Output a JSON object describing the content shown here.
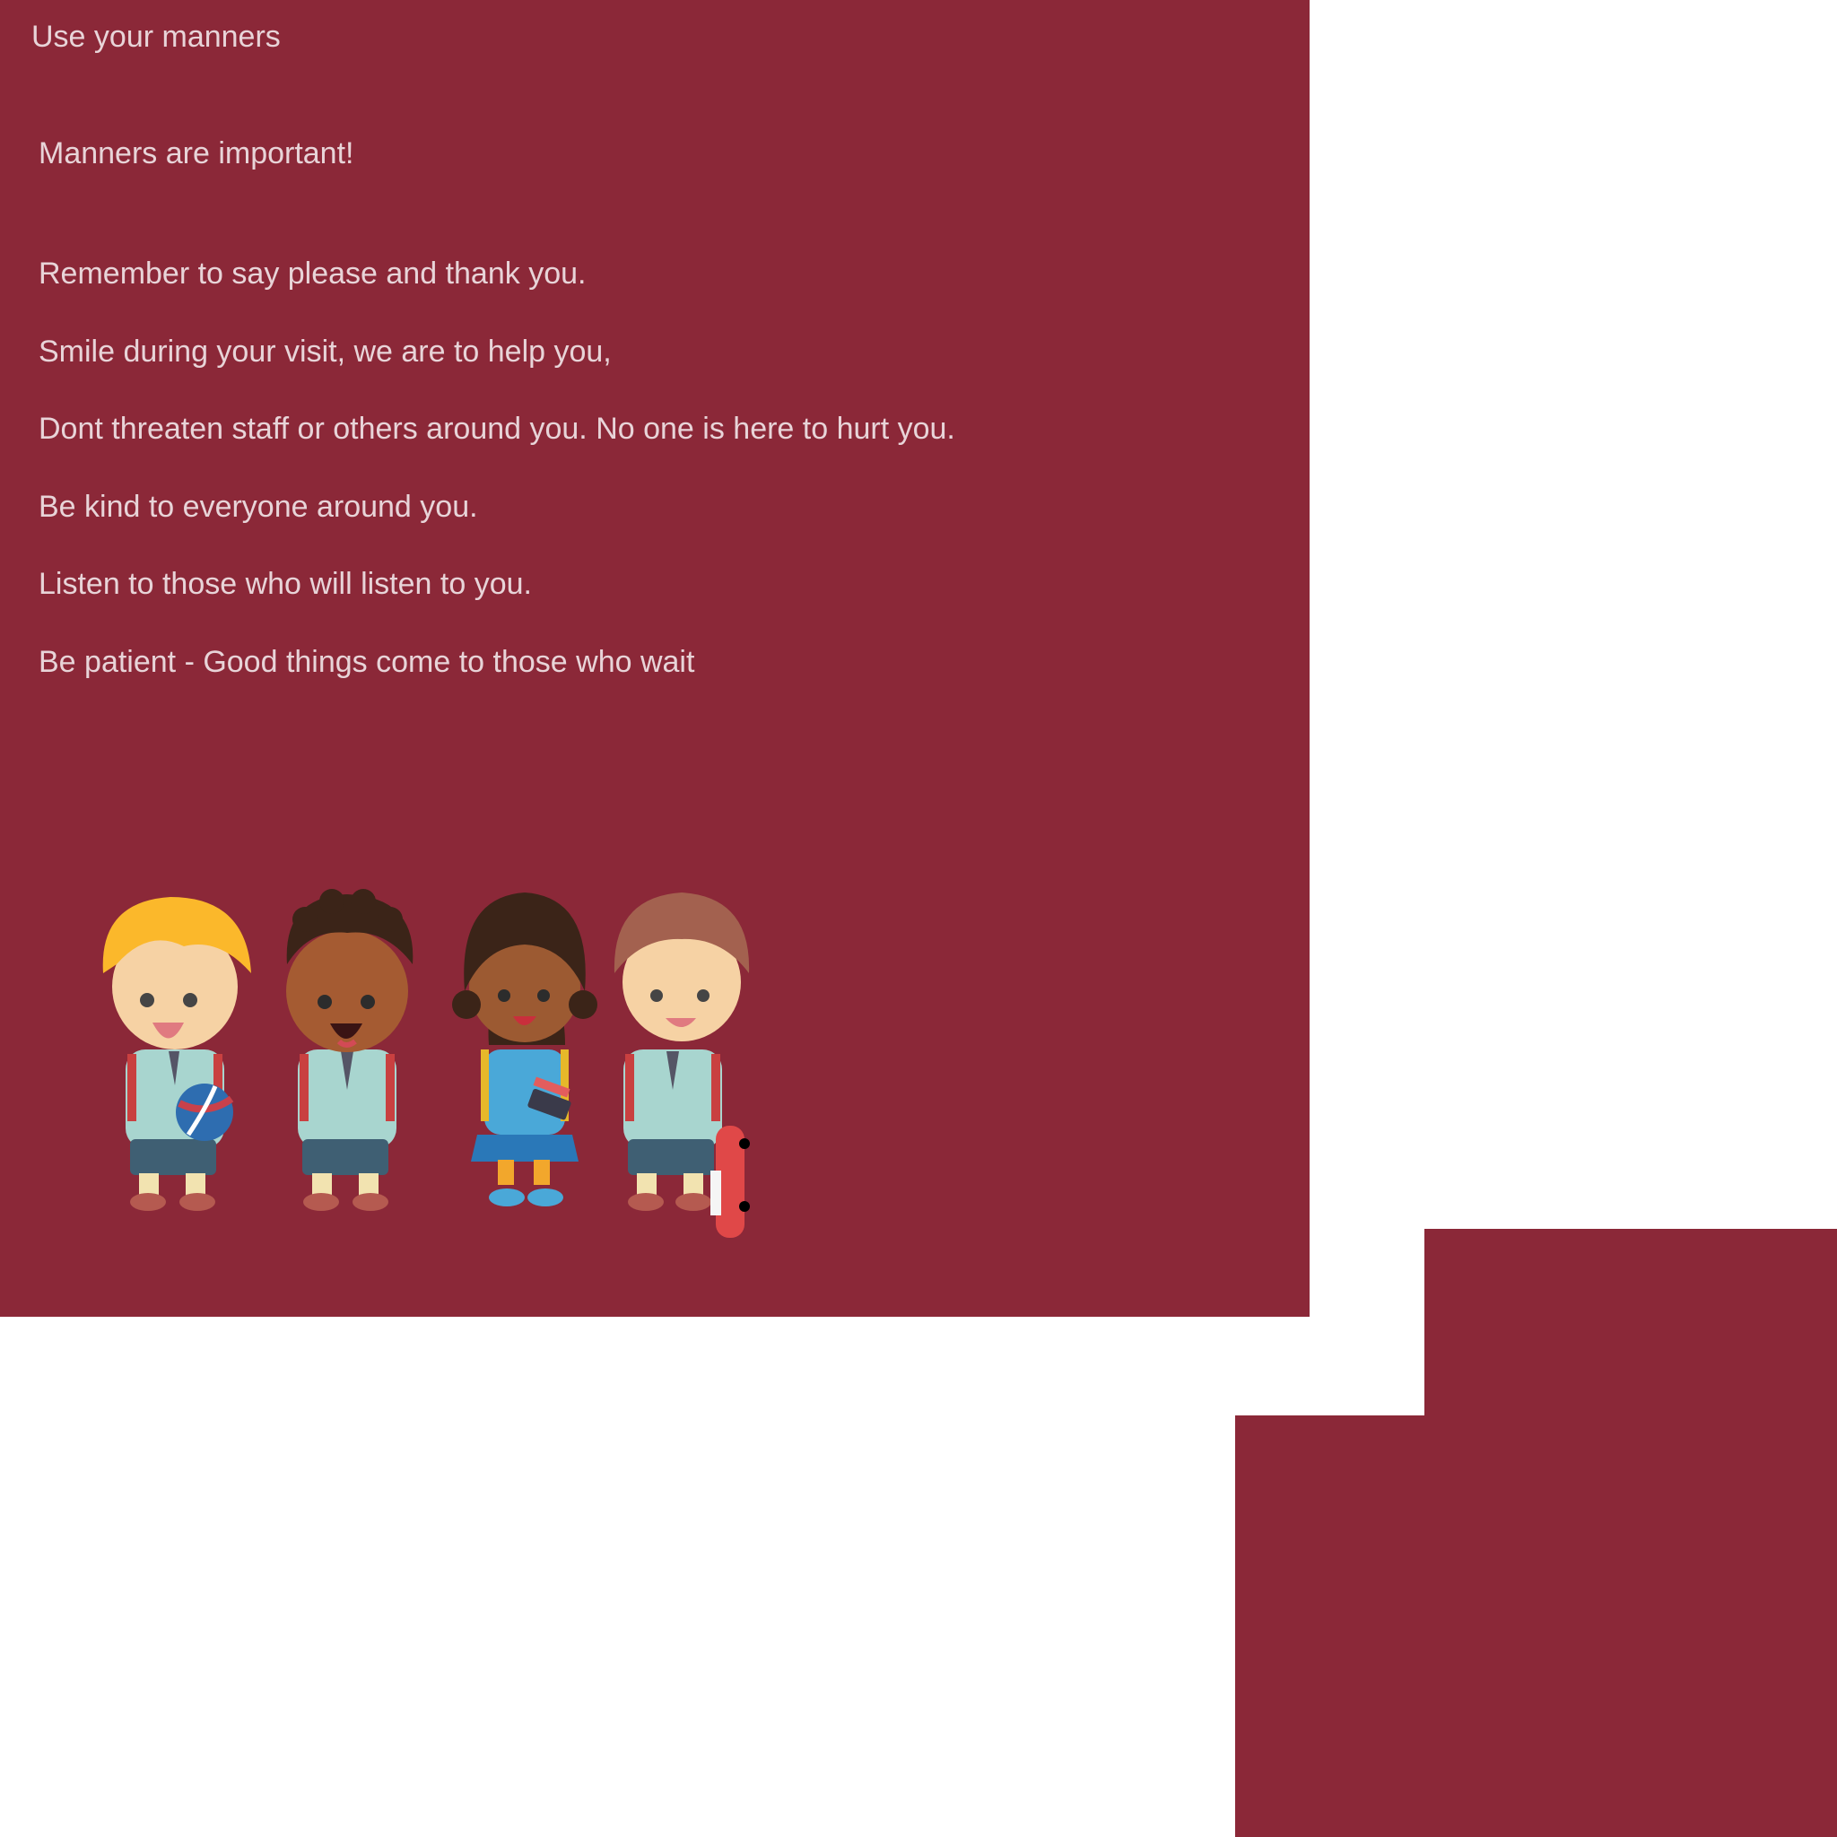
{
  "title": "Use your manners",
  "heading": "Manners are important!",
  "rules": [
    "Remember to say please and thank you.",
    "Smile during your visit, we are to help you,",
    "Dont threaten staff or others around you. No one is here to hurt you.",
    "Be kind to everyone around you.",
    "Listen to those who will listen to you.",
    "Be patient - Good things come to those who wait"
  ],
  "colors": {
    "panel": "#8b2838",
    "text": "#e8d4d8",
    "background": "#ffffff"
  },
  "illustration": {
    "description": "four cartoon school children",
    "icons": [
      "child-blond-volleyball-icon",
      "child-curly-hair-icon",
      "child-girl-books-icon",
      "child-skateboard-icon"
    ]
  }
}
